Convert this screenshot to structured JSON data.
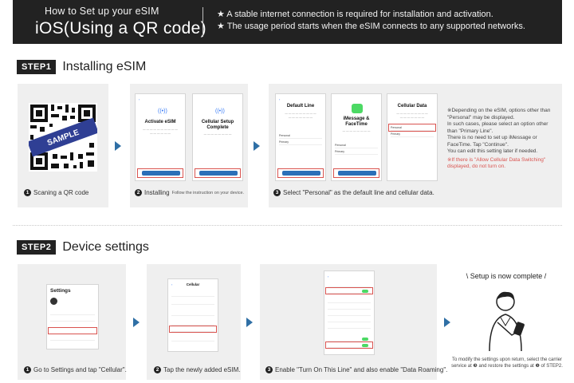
{
  "header": {
    "subtitle": "How to Set up your eSIM",
    "title": "iOS(Using a QR code)",
    "notes": [
      "★ A stable internet connection is required for installation and activation.",
      "★ The usage period starts when the eSIM connects to any supported networks."
    ]
  },
  "step1": {
    "badge": "STEP1",
    "title": "Installing eSIM",
    "qr_sample": "SAMPLE",
    "captions": [
      {
        "num": "1",
        "text": "Scaning a QR code",
        "small": ""
      },
      {
        "num": "2",
        "text": "Installing",
        "small": "Follow the instruction on your device."
      },
      {
        "num": "3",
        "text": "Select \"Personal\" as the default line and cellular data.",
        "small": ""
      }
    ],
    "screens": {
      "activate_title": "Activate eSIM",
      "complete_title": "Cellular Setup Complete",
      "default_line_title": "Default Line",
      "imessage_title": "iMessage & FaceTime",
      "cellular_data_title": "Cellular Data",
      "personal": "Personal",
      "primary": "Primary"
    },
    "note": {
      "lines": [
        "※Depending on the eSIM, options other than \"Personal\" may be displayed.",
        "In such cases, please select an option other than \"Primary Line\".",
        "There is no need to set up iMessage or FaceTime. Tap \"Continue\".",
        "You can edit this setting later if needed."
      ],
      "warning": "※If there is \"Allow Cellular Data Switching\" displayed, do not turn on."
    }
  },
  "step2": {
    "badge": "STEP2",
    "title": "Device settings",
    "captions": [
      {
        "num": "1",
        "text": "Go to Settings and tap \"Cellular\"."
      },
      {
        "num": "2",
        "text": "Tap the newly added eSIM."
      },
      {
        "num": "3",
        "text": "Enable \"Turn On This Line\" and also enable \"Data Roaming\"."
      }
    ],
    "screens": {
      "settings_title": "Settings",
      "cellular_title": "Cellular"
    },
    "complete": "\\ Setup is now complete /",
    "complete_note": "To modify the settings upon return, select the carrier service at ❸ and restore the settings at ❶ of STEP2."
  },
  "colors": {
    "header_bg": "#222222",
    "arrow": "#2f6fa5",
    "highlight": "#d9534f",
    "panel_bg": "#efefef"
  }
}
